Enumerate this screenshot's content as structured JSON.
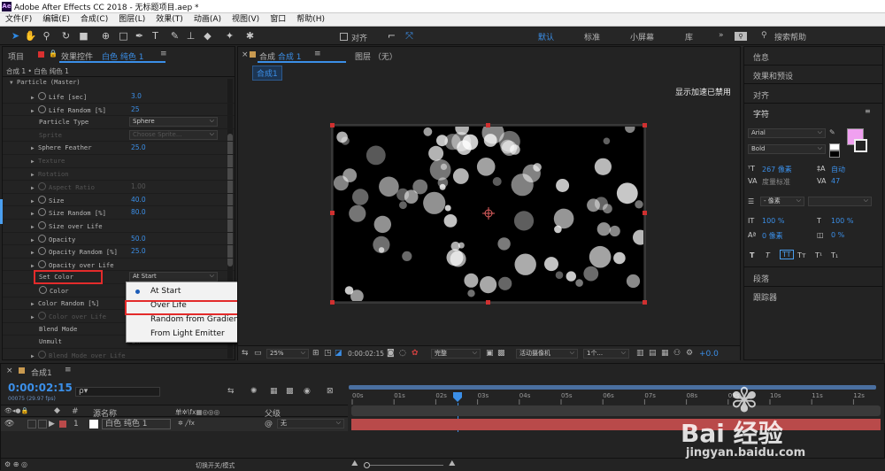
{
  "app": {
    "logo": "Ae",
    "title": "Adobe After Effects CC 2018 - 无标题项目.aep *"
  },
  "menu": [
    "文件(F)",
    "编辑(E)",
    "合成(C)",
    "图层(L)",
    "效果(T)",
    "动画(A)",
    "视图(V)",
    "窗口",
    "帮助(H)"
  ],
  "toolbar": {
    "align_label": "对齐",
    "workspaces": [
      "默认",
      "标准",
      "小屏幕",
      "库"
    ],
    "search_placeholder": "搜索帮助"
  },
  "left_panel": {
    "tab_project": "项目",
    "tab_effects": "效果控件",
    "effects_target": "白色 纯色 1",
    "breadcrumb": "合成 1 • 白色 纯色 1",
    "plugin_header": "Particle (Master)",
    "rows": [
      {
        "name": "Life [sec]",
        "value": "3.0"
      },
      {
        "name": "Life Random [%]",
        "value": "25"
      },
      {
        "name": "Particle Type",
        "value": "Sphere"
      },
      {
        "name": "Sprite",
        "value": "Choose Sprite..."
      },
      {
        "name": "Sphere Feather",
        "value": "25.0"
      },
      {
        "name": "Texture",
        "value": ""
      },
      {
        "name": "Rotation",
        "value": ""
      },
      {
        "name": "Aspect Ratio",
        "value": "1.00"
      },
      {
        "name": "Size",
        "value": "40.0"
      },
      {
        "name": "Size Random [%]",
        "value": "80.0"
      },
      {
        "name": "Size over Life",
        "value": ""
      },
      {
        "name": "Opacity",
        "value": "50.0"
      },
      {
        "name": "Opacity Random [%]",
        "value": "25.0"
      },
      {
        "name": "Opacity over Life",
        "value": ""
      },
      {
        "name": "Set Color",
        "value": "At Start"
      },
      {
        "name": "Color",
        "value": ""
      },
      {
        "name": "Color Random [%]",
        "value": ""
      },
      {
        "name": "Color over Life",
        "value": ""
      },
      {
        "name": "Blend Mode",
        "value": ""
      },
      {
        "name": "Unmult",
        "value": "Off"
      },
      {
        "name": "Blend Mode over Life",
        "value": ""
      }
    ],
    "popup": {
      "options": [
        "At Start",
        "Over Life",
        "Random from Gradient",
        "From Light Emitter"
      ],
      "selected": "At Start"
    }
  },
  "comp_panel": {
    "tab": "合成",
    "tab_name": "合成 1",
    "layer_tab": "图层 （无）",
    "subtab": "合成1",
    "accel_msg": "显示加速已禁用",
    "zoom": "25%",
    "timecode": "0:00:02:15",
    "quality": "完整",
    "camera": "活动摄像机",
    "views": "1个...",
    "offset": "+0.0"
  },
  "right_panel": {
    "info": "信息",
    "effects_presets": "效果和预设",
    "align": "对齐",
    "character": "字符",
    "font": "Arial",
    "style": "Bold",
    "font_size": "267 像素",
    "leading": "自动",
    "kerning": "度量标准",
    "tracking": "47",
    "stroke": "- 像素",
    "vscale": "100 %",
    "hscale": "100 %",
    "baseline": "0 像素",
    "tsume": "0 %",
    "paragraph": "段落",
    "tracker": "跟踪器",
    "fill_color": "#f0a0f0"
  },
  "timeline": {
    "tab": "合成1",
    "timecode": "0:00:02:15",
    "frames": "00075 (29.97 fps)",
    "search_placeholder": "ρ▾",
    "col_num": "#",
    "col_name": "源名称",
    "col_switches": "单✲\\fx▦◎◎◎",
    "col_parent": "父级",
    "layer_num": "1",
    "layer_name": "白色 纯色 1",
    "parent_value": "无",
    "ruler": [
      "00s",
      "01s",
      "02s",
      "03s",
      "04s",
      "05s",
      "06s",
      "07s",
      "08s",
      "09s",
      "10s",
      "11s",
      "12s"
    ],
    "footer": "切换开关/模式",
    "layer_color": "#b94a4a"
  },
  "watermark": {
    "brand": "Bai 经验",
    "url": "jingyan.baidu.com"
  }
}
